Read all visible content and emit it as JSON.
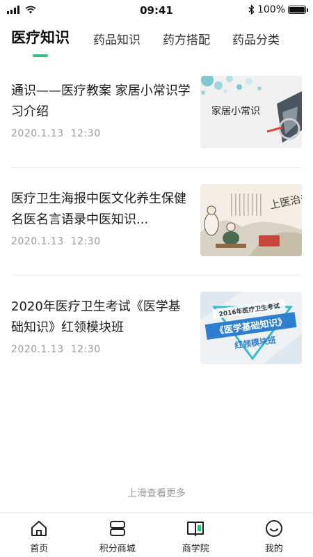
{
  "status_bar": {
    "time": "09:41",
    "battery_text": "100%",
    "battery_level": 1.0
  },
  "tabs": [
    {
      "label": "医疗知识",
      "active": true
    },
    {
      "label": "药品知识",
      "active": false
    },
    {
      "label": "药方搭配",
      "active": false
    },
    {
      "label": "药品分类",
      "active": false
    }
  ],
  "articles": [
    {
      "title": "通识——医疗教案 家居小常识学习介绍",
      "date": "2020.1.13",
      "time": "12:30",
      "thumb_text": "家居小常识"
    },
    {
      "title": "医疗卫生海报中医文化养生保健名医名言语录中医知识...",
      "date": "2020.1.13",
      "time": "12:30",
      "thumb_text": "上医治未病"
    },
    {
      "title": "2020年医疗卫生考试《医学基础知识》红领模块班",
      "date": "2020.1.13",
      "time": "12:30",
      "thumb_line1": "2016年医疗卫生考试",
      "thumb_line2": "《医学基础知识》",
      "thumb_line3": "红领模块班"
    }
  ],
  "more_hint": "上滑查看更多",
  "bottom_nav": [
    {
      "label": "首页",
      "icon": "home-icon"
    },
    {
      "label": "积分商城",
      "icon": "points-mall-icon"
    },
    {
      "label": "商学院",
      "icon": "book-icon"
    },
    {
      "label": "我的",
      "icon": "smiley-icon"
    }
  ],
  "colors": {
    "accent": "#2ec27e",
    "meta_text": "#9a9a9a"
  }
}
